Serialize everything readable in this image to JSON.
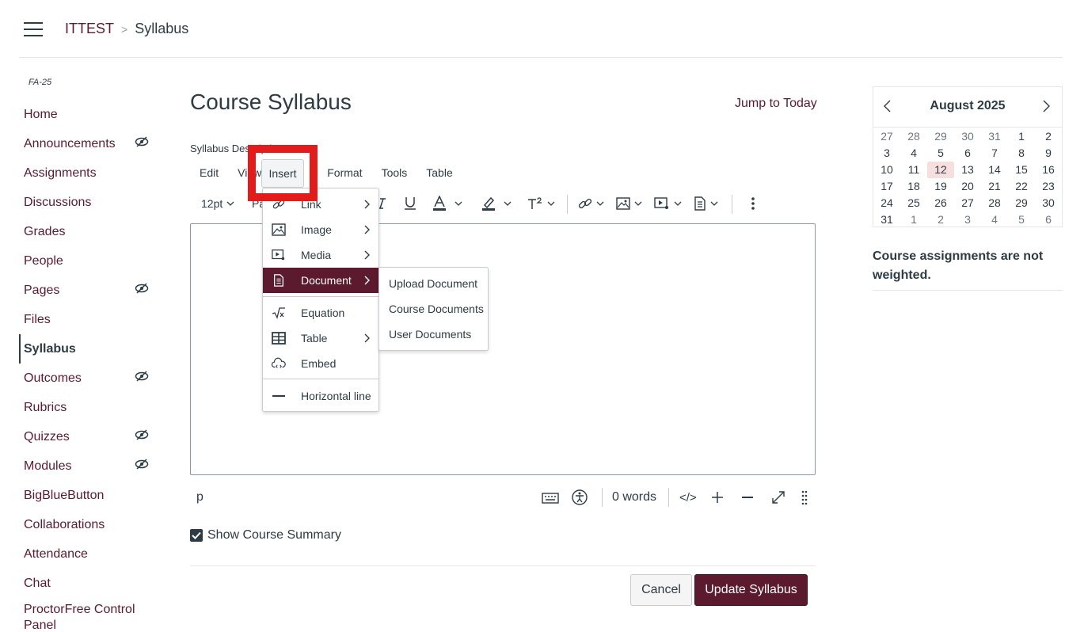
{
  "breadcrumb": {
    "course": "ITTEST",
    "separator": ">",
    "current": "Syllabus"
  },
  "sidebar": {
    "term": "FA-25",
    "items": [
      {
        "label": "Home",
        "hidden": false
      },
      {
        "label": "Announcements",
        "hidden": true
      },
      {
        "label": "Assignments",
        "hidden": false
      },
      {
        "label": "Discussions",
        "hidden": false
      },
      {
        "label": "Grades",
        "hidden": false
      },
      {
        "label": "People",
        "hidden": false
      },
      {
        "label": "Pages",
        "hidden": true
      },
      {
        "label": "Files",
        "hidden": false
      },
      {
        "label": "Syllabus",
        "hidden": false,
        "active": true
      },
      {
        "label": "Outcomes",
        "hidden": true
      },
      {
        "label": "Rubrics",
        "hidden": false
      },
      {
        "label": "Quizzes",
        "hidden": true
      },
      {
        "label": "Modules",
        "hidden": true
      },
      {
        "label": "BigBlueButton",
        "hidden": false
      },
      {
        "label": "Collaborations",
        "hidden": false
      },
      {
        "label": "Attendance",
        "hidden": false
      },
      {
        "label": "Chat",
        "hidden": false
      },
      {
        "label": "ProctorFree Control Panel",
        "hidden": false
      }
    ]
  },
  "main": {
    "title": "Course Syllabus",
    "jump_to_today": "Jump to Today",
    "description_label": "Syllabus Description:"
  },
  "editor": {
    "menubar": [
      "Edit",
      "View",
      "Insert",
      "Format",
      "Tools",
      "Table"
    ],
    "toolbar": {
      "font_size": "12pt",
      "paragraph": "Paragraph"
    },
    "status": {
      "element_path": "p",
      "word_count": "0 words",
      "html_toggle": "</>"
    }
  },
  "insert_menu": {
    "items": [
      "Link",
      "Image",
      "Media",
      "Document",
      "Equation",
      "Table",
      "Embed",
      "Horizontal line"
    ],
    "selected": "Document"
  },
  "document_submenu": [
    "Upload Document",
    "Course Documents",
    "User Documents"
  ],
  "options": {
    "show_course_summary": "Show Course Summary",
    "show_course_summary_checked": true
  },
  "actions": {
    "cancel": "Cancel",
    "update": "Update Syllabus"
  },
  "calendar": {
    "title": "August 2025",
    "weeks": [
      [
        "27",
        "28",
        "29",
        "30",
        "31",
        "1",
        "2"
      ],
      [
        "3",
        "4",
        "5",
        "6",
        "7",
        "8",
        "9"
      ],
      [
        "10",
        "11",
        "12",
        "13",
        "14",
        "15",
        "16"
      ],
      [
        "17",
        "18",
        "19",
        "20",
        "21",
        "22",
        "23"
      ],
      [
        "24",
        "25",
        "26",
        "27",
        "28",
        "29",
        "30"
      ],
      [
        "31",
        "1",
        "2",
        "3",
        "4",
        "5",
        "6"
      ]
    ],
    "today": "12"
  },
  "weights_note": "Course assignments are not weighted.",
  "colors": {
    "brand": "#5b1a2e",
    "text": "#2d3b45",
    "highlight": "#e41b1b",
    "today_bg": "#f7dfe0"
  }
}
